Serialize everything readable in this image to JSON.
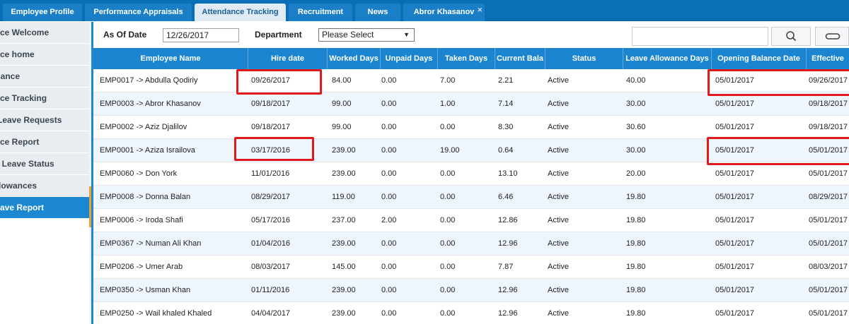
{
  "tabs": [
    {
      "label": "Employee Profile"
    },
    {
      "label": "Performance Appraisals"
    },
    {
      "label": "Attendance Tracking"
    },
    {
      "label": "Recruitment"
    },
    {
      "label": "News"
    },
    {
      "label": "Abror Khasanov"
    }
  ],
  "active_tab": "Attendance Tracking",
  "sidebar": {
    "items": [
      {
        "label": "ance Welcome"
      },
      {
        "label": "ance home"
      },
      {
        "label": "ndance"
      },
      {
        "label": "ance Tracking"
      },
      {
        "label": "e Leave Requests"
      },
      {
        "label": "ance Report"
      },
      {
        "label": "ee Leave Status"
      },
      {
        "label": "Allowances"
      },
      {
        "label": " Leave Report"
      }
    ],
    "active_label": " Leave Report"
  },
  "filters": {
    "as_of_label": "As Of Date",
    "as_of_value": "12/26/2017",
    "department_label": "Department",
    "department_value": "Please Select"
  },
  "icons": {
    "search": "search-icon",
    "refresh": "refresh-icon",
    "caret": "chevron-down-icon"
  },
  "table": {
    "columns": [
      "Employee Name",
      "Hire date",
      "Worked Days",
      "Unpaid Days",
      "Taken Days",
      "Current Bala",
      "Status",
      "Leave Allowance Days",
      "Opening Balance Date",
      "Effective"
    ],
    "rows": [
      [
        "EMP0017 -> Abdulla Qodiriy",
        "09/26/2017",
        "84.00",
        "0.00",
        "7.00",
        "2.21",
        "Active",
        "40.00",
        "05/01/2017",
        "09/26/2017"
      ],
      [
        "EMP0003 -> Abror Khasanov",
        "09/18/2017",
        "99.00",
        "0.00",
        "1.00",
        "7.14",
        "Active",
        "30.00",
        "05/01/2017",
        "09/18/2017"
      ],
      [
        "EMP0002 -> Aziz Djalilov",
        "09/18/2017",
        "99.00",
        "0.00",
        "0.00",
        "8.30",
        "Active",
        "30.60",
        "05/01/2017",
        "09/18/2017"
      ],
      [
        "EMP0001 -> Aziza Israilova",
        "03/17/2016",
        "239.00",
        "0.00",
        "19.00",
        "0.64",
        "Active",
        "30.00",
        "05/01/2017",
        "05/01/2017"
      ],
      [
        "EMP0060 -> Don York",
        "11/01/2016",
        "239.00",
        "0.00",
        "0.00",
        "13.10",
        "Active",
        "20.00",
        "05/01/2017",
        "05/01/2017"
      ],
      [
        "EMP0008 -> Donna Balan",
        "08/29/2017",
        "119.00",
        "0.00",
        "0.00",
        "6.46",
        "Active",
        "19.80",
        "05/01/2017",
        "08/29/2017"
      ],
      [
        "EMP0006 -> Iroda Shafi",
        "05/17/2016",
        "237.00",
        "2.00",
        "0.00",
        "12.86",
        "Active",
        "19.80",
        "05/01/2017",
        "05/01/2017"
      ],
      [
        "EMP0367 -> Numan Ali Khan",
        "01/04/2016",
        "239.00",
        "0.00",
        "0.00",
        "12.96",
        "Active",
        "19.80",
        "05/01/2017",
        "05/01/2017"
      ],
      [
        "EMP0206 -> Umer Arab",
        "08/03/2017",
        "145.00",
        "0.00",
        "0.00",
        "7.87",
        "Active",
        "19.80",
        "05/01/2017",
        "08/03/2017"
      ],
      [
        "EMP0350 -> Usman Khan",
        "01/11/2016",
        "239.00",
        "0.00",
        "0.00",
        "12.96",
        "Active",
        "19.80",
        "05/01/2017",
        "05/01/2017"
      ],
      [
        "EMP0250 -> Wail khaled Khaled",
        "04/04/2017",
        "239.00",
        "0.00",
        "0.00",
        "12.96",
        "Active",
        "19.80",
        "05/01/2017",
        "05/01/2017"
      ]
    ]
  },
  "colors": {
    "tabbar": "#0a6fb6",
    "header": "#1b86cf",
    "row_alt": "#eef5fd",
    "highlight": "#e0191c",
    "sidebar_active": "#1d88d2"
  }
}
